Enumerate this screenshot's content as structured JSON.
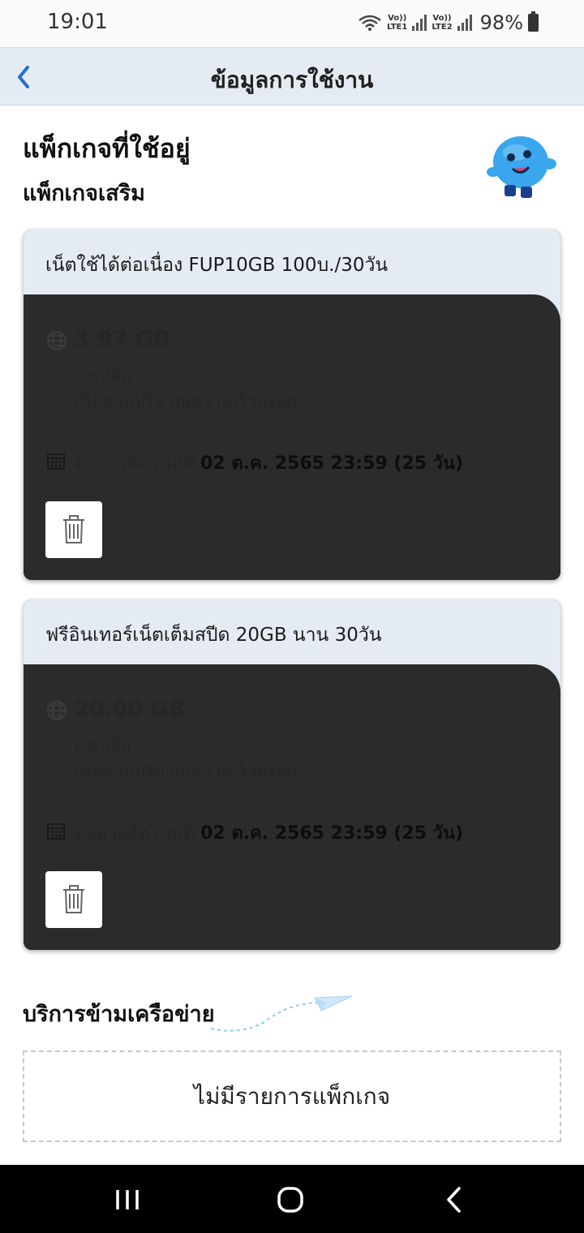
{
  "status_bar": {
    "time": "19:01",
    "sim1_top": "Vo))",
    "sim1_bottom": "LTE1",
    "sim2_top": "Vo))",
    "sim2_bottom": "LTE2",
    "battery": "98%"
  },
  "header": {
    "title": "ข้อมูลการใช้งาน"
  },
  "sections": {
    "active_packages": "แพ็กเกจที่ใช้อยู่",
    "addon": "แพ็กเกจเสริม",
    "roaming": "บริการข้ามเครือข่าย"
  },
  "packages": [
    {
      "title": "เน็ตใช้ได้ต่อเนื่อง FUP10GB  100บ./30วัน",
      "amount": "3.97 GB",
      "remain_label": "คงเหลือ",
      "desc": "เน็ตตามปริมาณความเร็วสูงสุด",
      "renew_label": "ต่ออายุอัตโนมัติ",
      "renew_date": "02 ต.ค. 2565 23:59 (25 วัน)"
    },
    {
      "title": "ฟรีอินเทอร์เน็ตเต็มสปีด  20GB นาน 30วัน",
      "amount": "20.00 GB",
      "remain_label": "คงเหลือ",
      "desc": "เน็ตตามปริมาณความเร็วสูงสุด",
      "renew_label": "ต่ออายุอัตโนมัติ",
      "renew_date": "02 ต.ค. 2565 23:59 (25 วัน)"
    }
  ],
  "roaming_empty": "ไม่มีรายการแพ็กเกจ",
  "colors": {
    "header_bg": "#e4ebf3",
    "accent": "#1e6fd0",
    "card_body": "#2b2b2b"
  },
  "icons": [
    "back-chevron-icon",
    "globe-icon",
    "calendar-icon",
    "trash-icon",
    "paper-plane-icon",
    "mascot-icon",
    "recent-apps-icon",
    "home-icon",
    "back-icon"
  ]
}
